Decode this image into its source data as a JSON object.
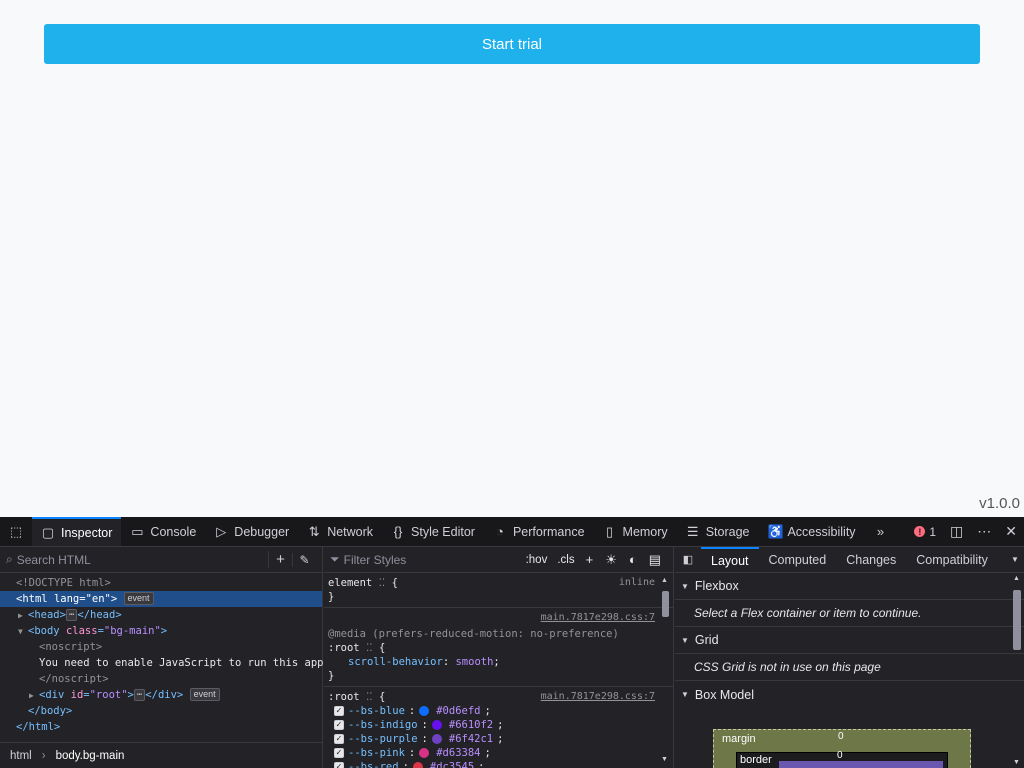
{
  "page": {
    "cta_label": "Start trial",
    "version": "v1.0.0"
  },
  "toolbar": {
    "tabs": [
      {
        "label": "Inspector",
        "icon": "inspector-icon"
      },
      {
        "label": "Console",
        "icon": "console-icon"
      },
      {
        "label": "Debugger",
        "icon": "debugger-icon"
      },
      {
        "label": "Network",
        "icon": "network-icon"
      },
      {
        "label": "Style Editor",
        "icon": "style-editor-icon"
      },
      {
        "label": "Performance",
        "icon": "performance-icon"
      },
      {
        "label": "Memory",
        "icon": "memory-icon"
      },
      {
        "label": "Storage",
        "icon": "storage-icon"
      },
      {
        "label": "Accessibility",
        "icon": "accessibility-icon"
      }
    ],
    "error_count": "1"
  },
  "markup": {
    "search_placeholder": "Search HTML",
    "doctype": "<!DOCTYPE html>",
    "html_tag": "html",
    "html_lang_attr": "lang",
    "html_lang_val": "\"en\"",
    "event_badge": "event",
    "head_tag": "head",
    "body_tag": "body",
    "body_class_attr": "class",
    "body_class_val": "\"bg-main\"",
    "noscript_open": "<noscript>",
    "noscript_text": "You need to enable JavaScript to run this app.",
    "noscript_close": "</noscript>",
    "div_tag": "div",
    "div_id_attr": "id",
    "div_id_val": "\"root\"",
    "body_close": "</body>",
    "html_close": "</html>",
    "breadcrumbs": [
      "html",
      "body.bg-main"
    ]
  },
  "rules": {
    "filter_placeholder": "Filter Styles",
    "hov": ":hov",
    "cls": ".cls",
    "element_selector": "element",
    "inline_label": "inline",
    "media_source": "main.7817e298.css:7",
    "media_query": "@media (prefers-reduced-motion: no-preference)",
    "root_selector": ":root",
    "scroll_prop": "scroll-behavior",
    "scroll_val": "smooth",
    "root_source": "main.7817e298.css:7",
    "variables": [
      {
        "name": "--bs-blue",
        "value": "#0d6efd"
      },
      {
        "name": "--bs-indigo",
        "value": "#6610f2"
      },
      {
        "name": "--bs-purple",
        "value": "#6f42c1"
      },
      {
        "name": "--bs-pink",
        "value": "#d63384"
      },
      {
        "name": "--bs-red",
        "value": "#dc3545"
      }
    ]
  },
  "layout": {
    "tabs": [
      "Layout",
      "Computed",
      "Changes",
      "Compatibility"
    ],
    "flexbox_title": "Flexbox",
    "flexbox_msg": "Select a Flex container or item to continue.",
    "grid_title": "Grid",
    "grid_msg": "CSS Grid is not in use on this page",
    "boxmodel_title": "Box Model",
    "margin_label": "margin",
    "margin_top": "0",
    "border_label": "border",
    "border_top": "0"
  },
  "colors": {
    "cta": "#1fb1eb",
    "accent": "#0a84ff"
  }
}
